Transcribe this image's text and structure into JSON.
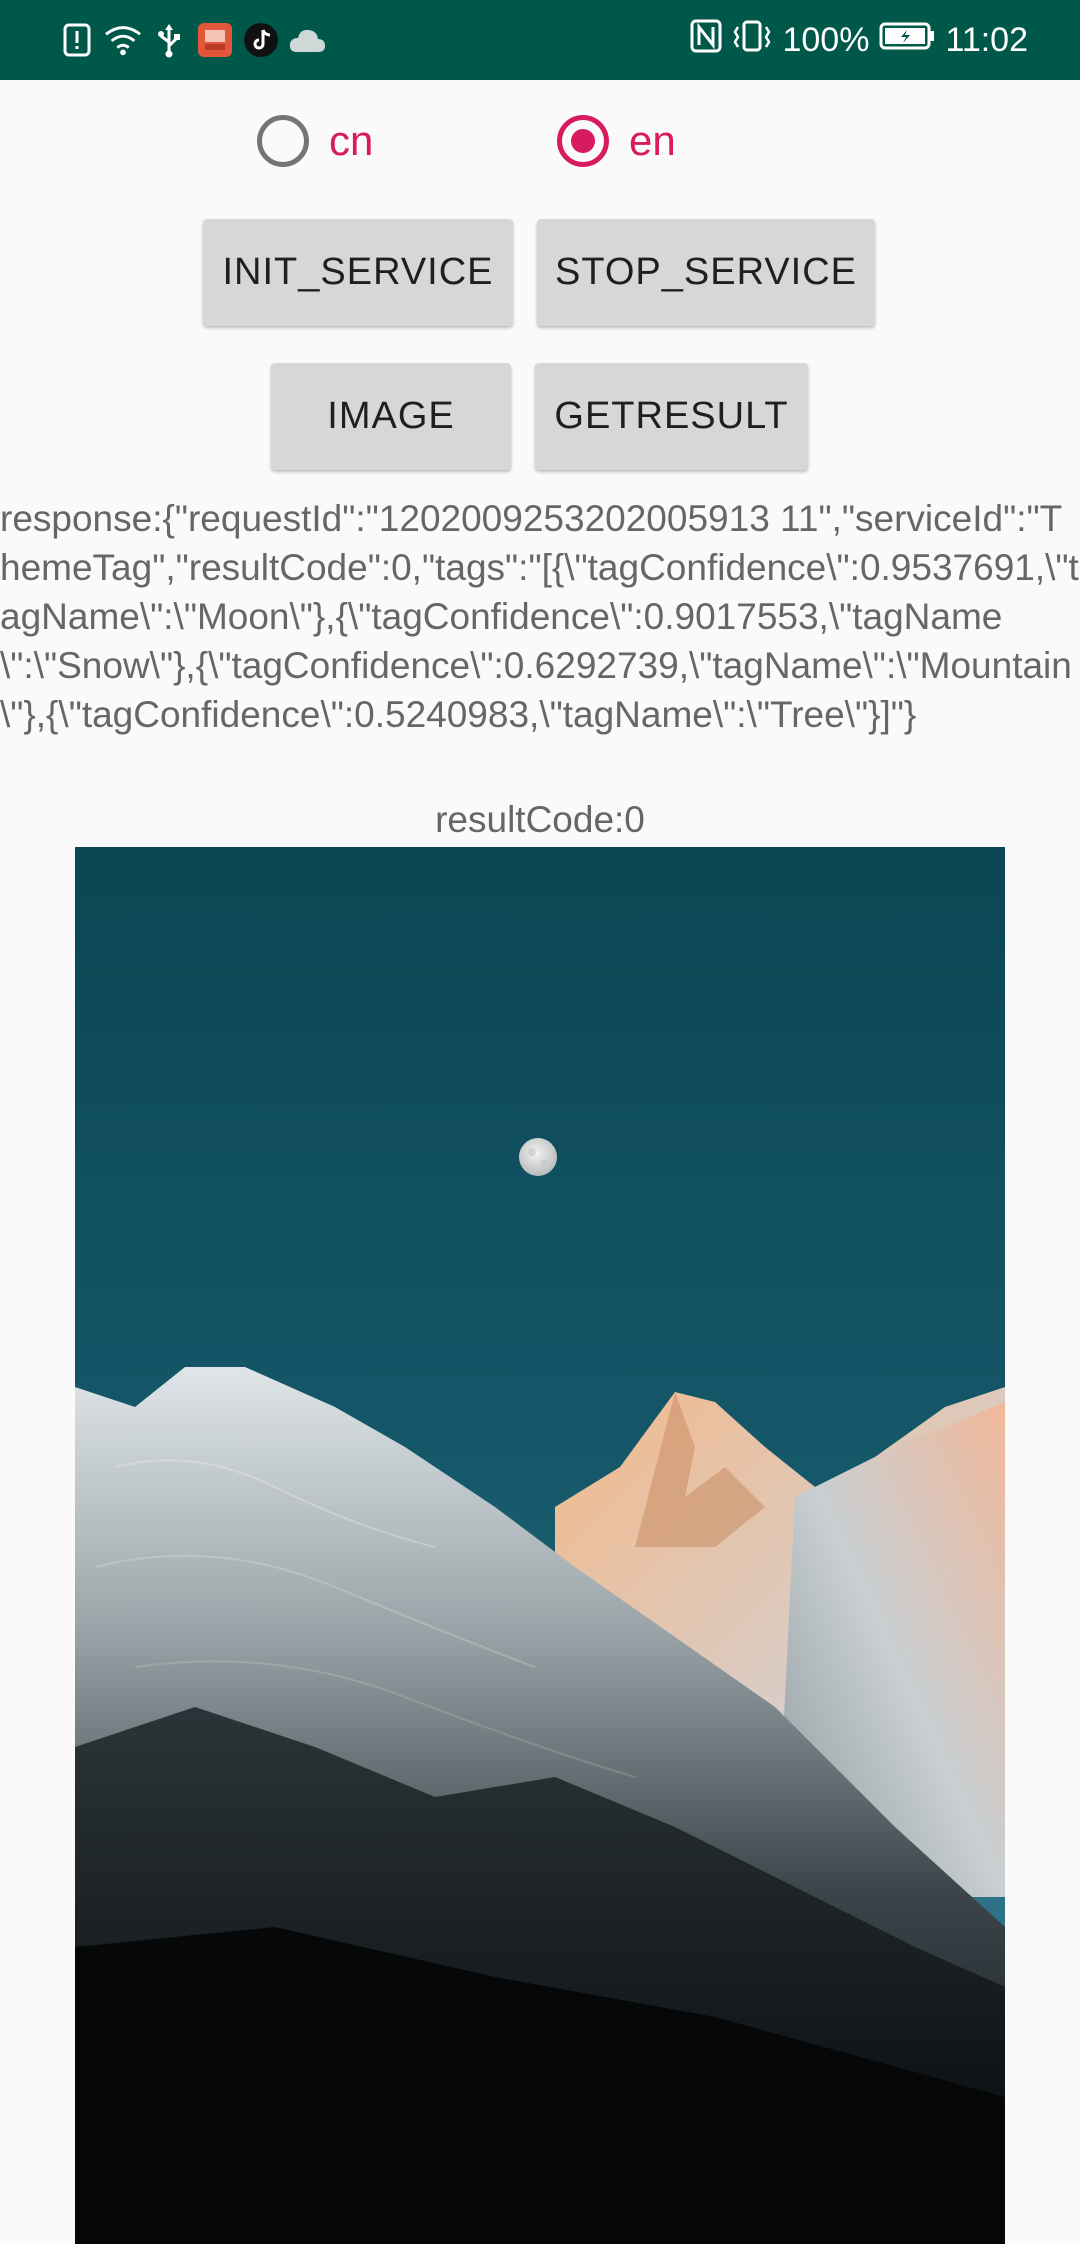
{
  "status_bar": {
    "battery_percent": "100%",
    "time": "11:02",
    "background_color": "#00584a",
    "left_icons": [
      "alert-icon",
      "wifi-icon",
      "usb-icon",
      "app-notification-icon",
      "tiktok-icon",
      "cloud-icon"
    ],
    "right_icons": [
      "nfc-icon",
      "vibrate-icon",
      "battery-icon"
    ]
  },
  "language": {
    "options": [
      {
        "label": "cn",
        "selected": false
      },
      {
        "label": "en",
        "selected": true
      }
    ],
    "accent_color": "#d81b60"
  },
  "buttons": {
    "init_service": "INIT_SERVICE",
    "stop_service": "STOP_SERVICE",
    "image": "IMAGE",
    "get_result": "GETRESULT"
  },
  "response_text": "response:{\"requestId\":\"1202009253202005913 11\",\"serviceId\":\"ThemeTag\",\"resultCode\":0,\"tags\":\"[{\\\"tagConfidence\\\":0.9537691,\\\"tagName\\\":\\\"Moon\\\"},{\\\"tagConfidence\\\":0.9017553,\\\"tagName\\\":\\\"Snow\\\"},{\\\"tagConfidence\\\":0.6292739,\\\"tagName\\\":\\\"Mountain\\\"},{\\\"tagConfidence\\\":0.5240983,\\\"tagName\\\":\\\"Tree\\\"}]\"}",
  "result_code_text": "resultCode:0",
  "photo": {
    "subject": "moon over snowy mountains"
  }
}
